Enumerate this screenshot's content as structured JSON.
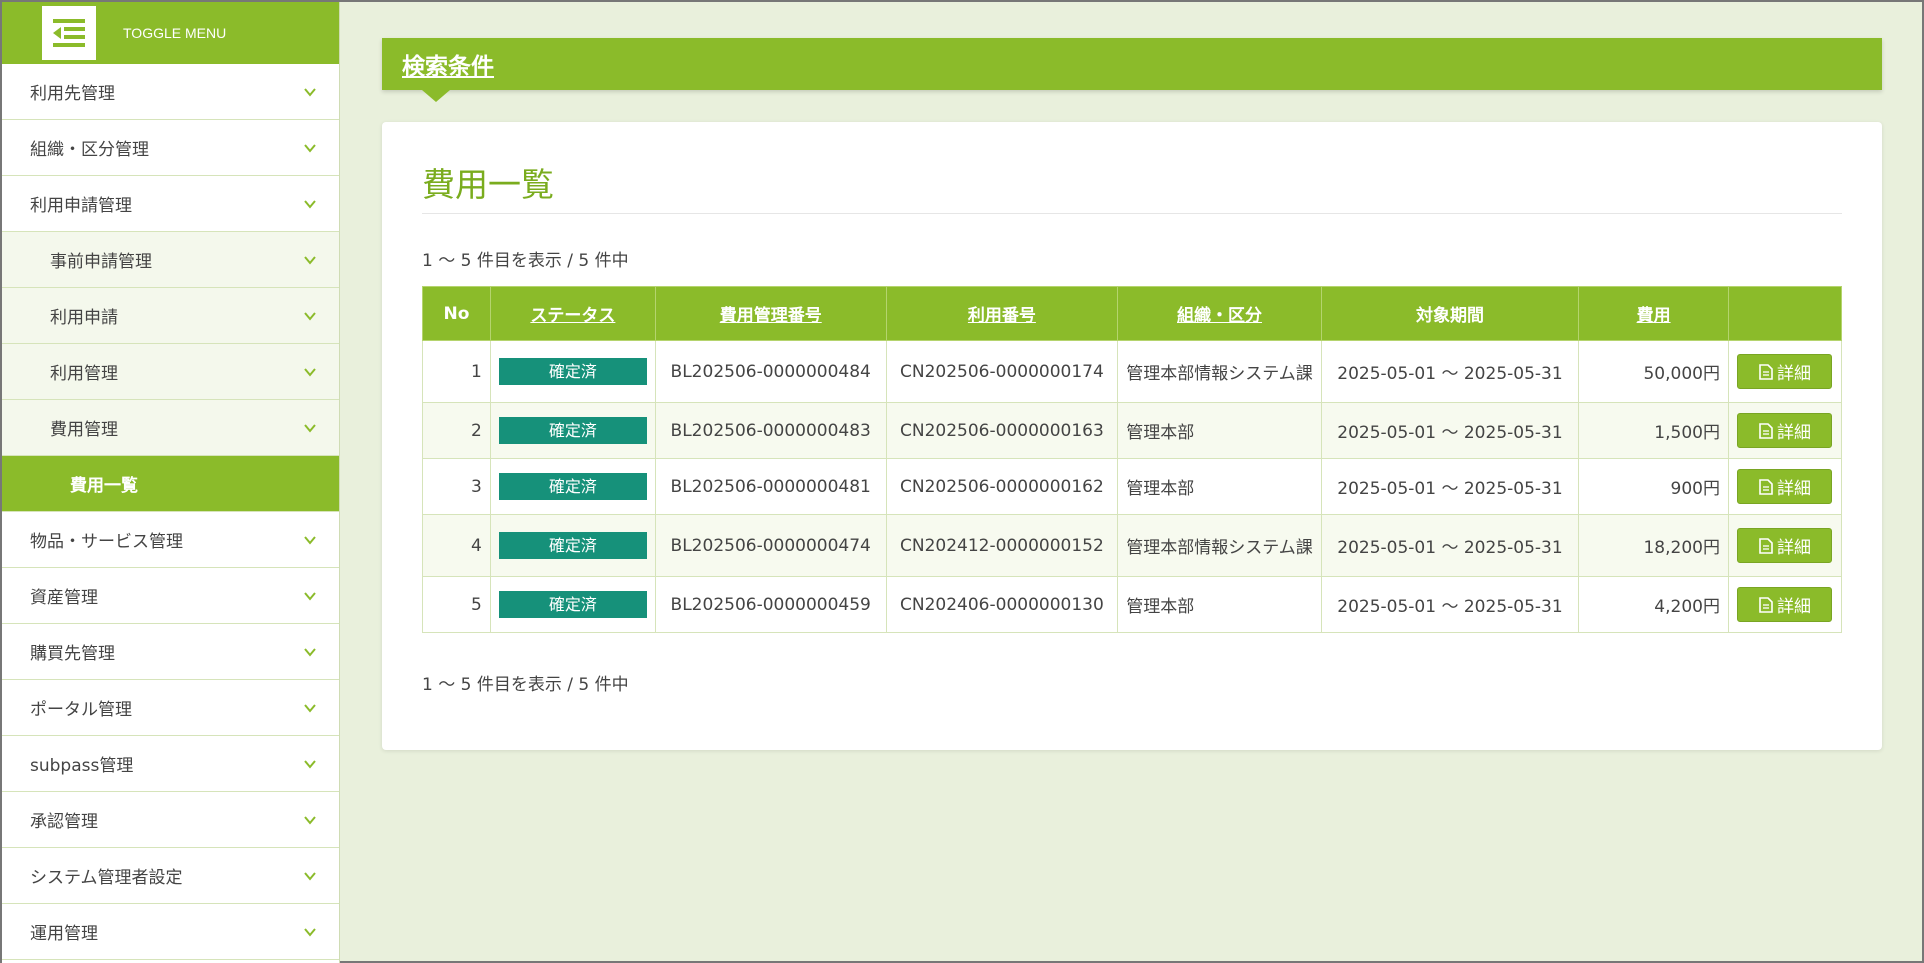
{
  "sidebar": {
    "toggle_label": "TOGGLE MENU",
    "items": [
      {
        "label": "利用先管理",
        "level": 0
      },
      {
        "label": "組織・区分管理",
        "level": 0
      },
      {
        "label": "利用申請管理",
        "level": 0
      },
      {
        "label": "事前申請管理",
        "level": 1
      },
      {
        "label": "利用申請",
        "level": 1
      },
      {
        "label": "利用管理",
        "level": 1
      },
      {
        "label": "費用管理",
        "level": 1
      },
      {
        "label": "費用一覧",
        "level": 2,
        "active": true
      },
      {
        "label": "物品・サービス管理",
        "level": 0
      },
      {
        "label": "資産管理",
        "level": 0
      },
      {
        "label": "購買先管理",
        "level": 0
      },
      {
        "label": "ポータル管理",
        "level": 0
      },
      {
        "label": "subpass管理",
        "level": 0
      },
      {
        "label": "承認管理",
        "level": 0
      },
      {
        "label": "システム管理者設定",
        "level": 0
      },
      {
        "label": "運用管理",
        "level": 0
      }
    ]
  },
  "search": {
    "title": "検索条件"
  },
  "main": {
    "title": "費用一覧",
    "count_top": "1 〜 5 件目を表示 / 5 件中",
    "count_bottom": "1 〜 5 件目を表示 / 5 件中"
  },
  "table": {
    "headers": [
      "No",
      "ステータス",
      "費用管理番号",
      "利用番号",
      "組織・区分",
      "対象期間",
      "費用",
      ""
    ],
    "rows": [
      {
        "no": "1",
        "status": "確定済",
        "cost_id": "BL202506-0000000484",
        "use_id": "CN202506-0000000174",
        "org": "管理本部情報システム課",
        "period": "2025-05-01 〜 2025-05-31",
        "cost": "50,000円",
        "action": "詳細"
      },
      {
        "no": "2",
        "status": "確定済",
        "cost_id": "BL202506-0000000483",
        "use_id": "CN202506-0000000163",
        "org": "管理本部",
        "period": "2025-05-01 〜 2025-05-31",
        "cost": "1,500円",
        "action": "詳細"
      },
      {
        "no": "3",
        "status": "確定済",
        "cost_id": "BL202506-0000000481",
        "use_id": "CN202506-0000000162",
        "org": "管理本部",
        "period": "2025-05-01 〜 2025-05-31",
        "cost": "900円",
        "action": "詳細"
      },
      {
        "no": "4",
        "status": "確定済",
        "cost_id": "BL202506-0000000474",
        "use_id": "CN202412-0000000152",
        "org": "管理本部情報システム課",
        "period": "2025-05-01 〜 2025-05-31",
        "cost": "18,200円",
        "action": "詳細"
      },
      {
        "no": "5",
        "status": "確定済",
        "cost_id": "BL202506-0000000459",
        "use_id": "CN202406-0000000130",
        "org": "管理本部",
        "period": "2025-05-01 〜 2025-05-31",
        "cost": "4,200円",
        "action": "詳細"
      }
    ]
  },
  "colors": {
    "accent": "#8bbb2a",
    "status": "#16917a",
    "background": "#e9f0dc"
  }
}
